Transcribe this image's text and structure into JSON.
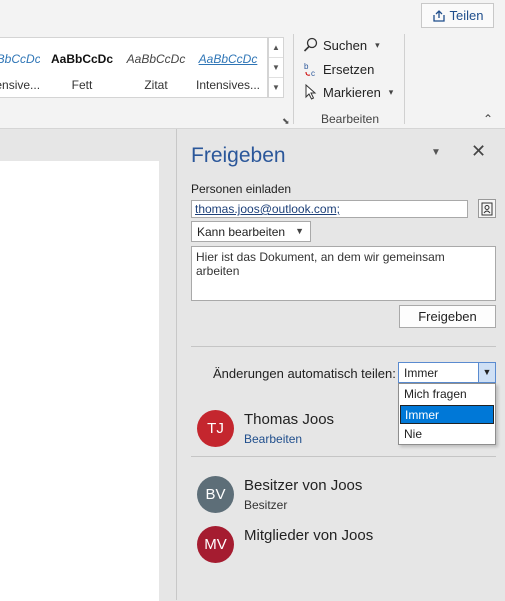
{
  "ribbon": {
    "share_button": "Teilen",
    "styles": [
      {
        "sample": "AaBbCcDc",
        "name": "Intensive..."
      },
      {
        "sample": "AaBbCcDc",
        "name": "Fett"
      },
      {
        "sample": "AaBbCcDc",
        "name": "Zitat"
      },
      {
        "sample": "AaBbCcDc",
        "name": "Intensives..."
      }
    ],
    "editing": {
      "find": "Suchen",
      "replace": "Ersetzen",
      "select": "Markieren",
      "group_label": "Bearbeiten"
    }
  },
  "share_pane": {
    "title": "Freigeben",
    "invite_label": "Personen einladen",
    "email_value": "thomas.joos@outlook.com;",
    "permission": "Kann bearbeiten",
    "message": "Hier ist das Dokument, an dem wir gemeinsam arbeiten",
    "share_button": "Freigeben",
    "auto_share_label": "Änderungen automatisch teilen:",
    "auto_share_value": "Immer",
    "auto_share_options": [
      "Mich fragen",
      "Immer",
      "Nie"
    ],
    "people": [
      {
        "initials": "TJ",
        "name": "Thomas Joos",
        "role": "Bearbeiten",
        "color": "#c4262e"
      },
      {
        "initials": "BV",
        "name": "Besitzer von Joos",
        "role": "Besitzer",
        "color": "#5d6e78"
      },
      {
        "initials": "MV",
        "name": "Mitglieder von Joos",
        "role": "",
        "color": "#a51c30"
      }
    ]
  },
  "icons": {
    "share": "share-icon",
    "find": "magnifier-icon",
    "replace": "replace-icon",
    "select": "cursor-icon",
    "address_book": "address-book-icon",
    "close": "close-icon"
  }
}
